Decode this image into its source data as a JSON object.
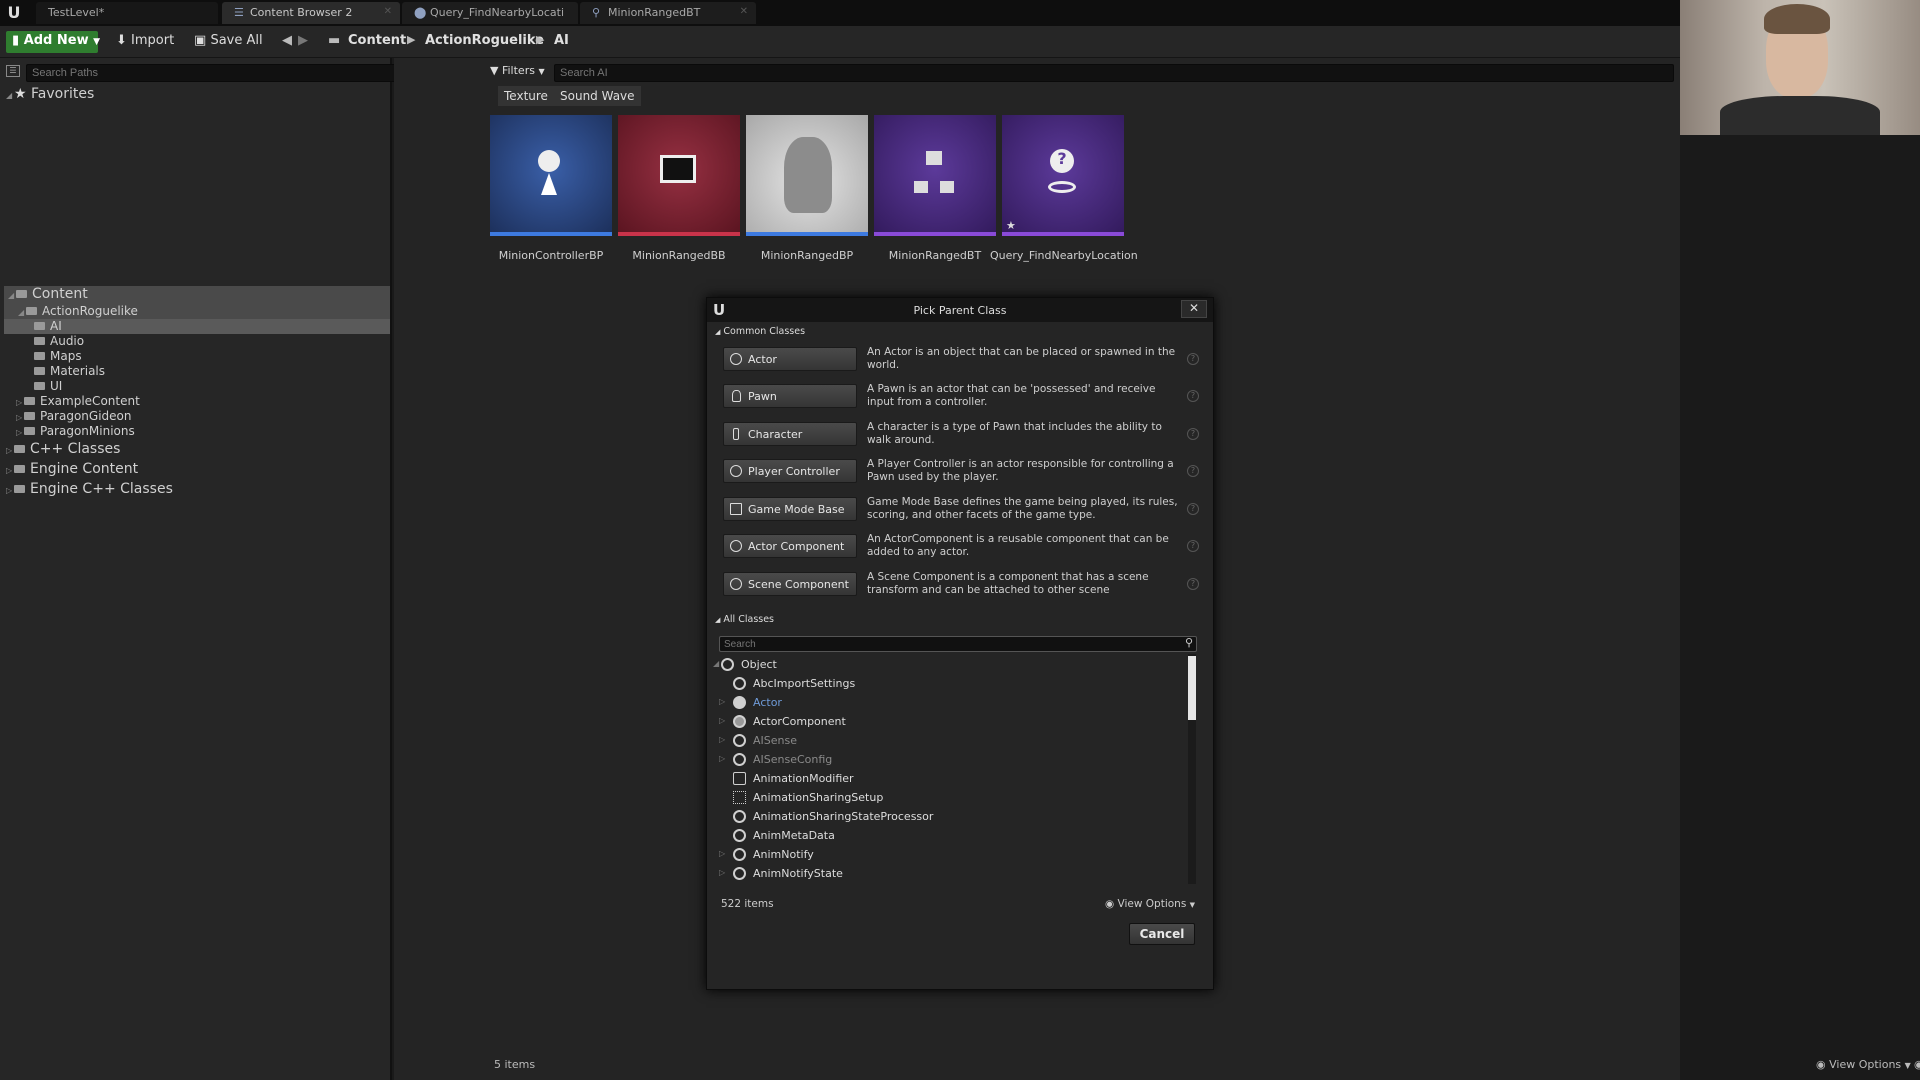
{
  "tabs": [
    {
      "label": "TestLevel*"
    },
    {
      "label": "Content Browser 2"
    },
    {
      "label": "Query_FindNearbyLocati"
    },
    {
      "label": "MinionRangedBT"
    }
  ],
  "toolbar": {
    "add_new": "Add New",
    "import": "Import",
    "save_all": "Save All",
    "breadcrumb": [
      "Content",
      "ActionRoguelike",
      "AI"
    ]
  },
  "sources": {
    "search_placeholder": "Search Paths",
    "favorites": "Favorites",
    "tree": [
      {
        "label": "Content"
      },
      {
        "label": "ActionRoguelike"
      },
      {
        "label": "AI"
      },
      {
        "label": "Audio"
      },
      {
        "label": "Maps"
      },
      {
        "label": "Materials"
      },
      {
        "label": "UI"
      },
      {
        "label": "ExampleContent"
      },
      {
        "label": "ParagonGideon"
      },
      {
        "label": "ParagonMinions"
      },
      {
        "label": "C++ Classes"
      },
      {
        "label": "Engine Content"
      },
      {
        "label": "Engine C++ Classes"
      }
    ]
  },
  "assets_view": {
    "filters_label": "Filters",
    "search_placeholder": "Search AI",
    "filter_chips": [
      "Texture",
      "Sound Wave"
    ],
    "assets": [
      {
        "name": "MinionControllerBP",
        "color": "#2a4a8a",
        "bar": "#3d7ae0"
      },
      {
        "name": "MinionRangedBB",
        "color": "#7a1e2e",
        "bar": "#c9334a"
      },
      {
        "name": "MinionRangedBP",
        "color": "#d8d8d8",
        "bar": "#3d7ae0"
      },
      {
        "name": "MinionRangedBT",
        "color": "#4a2a7a",
        "bar": "#8a4ad8"
      },
      {
        "name": "Query_FindNearbyLocation",
        "color": "#4a2a7a",
        "bar": "#8a4ad8"
      }
    ],
    "item_count": "5 items",
    "view_options": "View Options"
  },
  "dialog": {
    "title": "Pick Parent Class",
    "common_header": "Common Classes",
    "common": [
      {
        "label": "Actor",
        "desc": "An Actor is an object that can be placed or spawned in the world."
      },
      {
        "label": "Pawn",
        "desc": "A Pawn is an actor that can be 'possessed' and receive input from a controller."
      },
      {
        "label": "Character",
        "desc": "A character is a type of Pawn that includes the ability to walk around."
      },
      {
        "label": "Player Controller",
        "desc": "A Player Controller is an actor responsible for controlling a Pawn used by the player."
      },
      {
        "label": "Game Mode Base",
        "desc": "Game Mode Base defines the game being played, its rules, scoring, and other facets of the game type."
      },
      {
        "label": "Actor Component",
        "desc": "An ActorComponent is a reusable component that can be added to any actor."
      },
      {
        "label": "Scene Component",
        "desc": "A Scene Component is a component that has a scene transform and can be attached to other scene"
      }
    ],
    "all_header": "All Classes",
    "search_placeholder": "Search",
    "classes": [
      {
        "label": "Object"
      },
      {
        "label": "AbcImportSettings"
      },
      {
        "label": "Actor"
      },
      {
        "label": "ActorComponent"
      },
      {
        "label": "AISense"
      },
      {
        "label": "AISenseConfig"
      },
      {
        "label": "AnimationModifier"
      },
      {
        "label": "AnimationSharingSetup"
      },
      {
        "label": "AnimationSharingStateProcessor"
      },
      {
        "label": "AnimMetaData"
      },
      {
        "label": "AnimNotify"
      },
      {
        "label": "AnimNotifyState"
      }
    ],
    "item_count": "522 items",
    "view_options": "View Options",
    "cancel": "Cancel"
  }
}
